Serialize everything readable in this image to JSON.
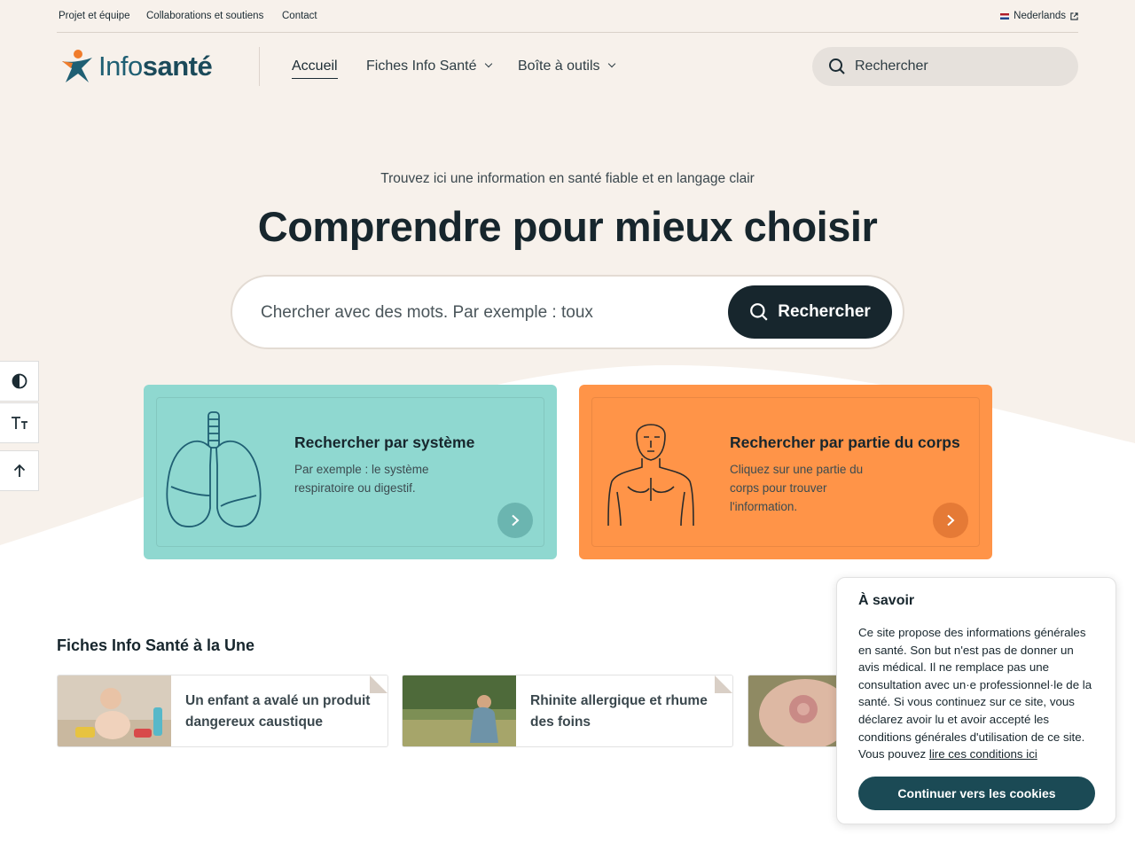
{
  "utility_nav": {
    "links": [
      "Projet et équipe",
      "Collaborations et soutiens",
      "Contact"
    ],
    "language": "Nederlands"
  },
  "brand": {
    "logo_part1": "Info",
    "logo_part2": "santé"
  },
  "main_nav": {
    "items": [
      "Accueil",
      "Fiches Info Santé",
      "Boîte à outils"
    ]
  },
  "header_search": {
    "placeholder": "Rechercher"
  },
  "hero": {
    "kicker": "Trouvez ici une information en santé fiable et en langage clair",
    "title": "Comprendre pour mieux choisir",
    "search_placeholder": "Chercher avec des mots. Par exemple : toux",
    "search_button": "Rechercher"
  },
  "cards": [
    {
      "title": "Rechercher par système",
      "text_lines": [
        "Par exemple : le système",
        "respiratoire ou digestif."
      ],
      "color": "#8fd8d0",
      "arrow_color": "#6bb5b0"
    },
    {
      "title": "Rechercher par partie du corps",
      "text_lines": [
        "Cliquez sur une partie du",
        "corps pour trouver",
        "l'information."
      ],
      "color": "#ff9448",
      "arrow_color": "#e57a36"
    }
  ],
  "featured": {
    "title": "Fiches Info Santé à la Une",
    "items": [
      {
        "title": "Un enfant a avalé un produit dangereux caustique"
      },
      {
        "title": "Rhinite allergique et rhume des foins"
      },
      {
        "title": ""
      }
    ]
  },
  "notice": {
    "title": "À savoir",
    "body": "Ce site propose des informations générales en santé. Son but n'est pas de donner un avis médical. Il ne remplace pas une consultation avec un·e professionnel·le de la santé. Si vous continuez sur ce site, vous déclarez avoir lu et avoir accepté les conditions générales d'utilisation de ce site. Vous pouvez",
    "link": "lire ces conditions ici",
    "button": "Continuer vers les cookies"
  },
  "colors": {
    "dark": "#17262d",
    "teal": "#8fd8d0",
    "orange": "#ff9448",
    "cream": "#f7f1eb",
    "logo_orange": "#f07c2b"
  }
}
